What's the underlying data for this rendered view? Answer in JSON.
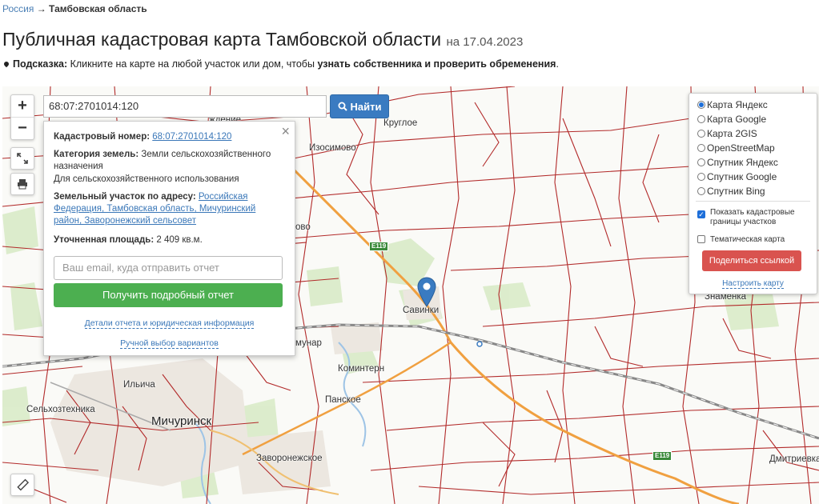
{
  "breadcrumb": {
    "root": "Россия",
    "arrow": "→",
    "current": "Тамбовская область"
  },
  "page": {
    "title": "Публичная кадастровая карта Тамбовской области",
    "date": "на 17.04.2023"
  },
  "hint": {
    "label": "Подсказка:",
    "text": "Кликните на карте на любой участок или дом, чтобы",
    "bold": "узнать собственника и проверить обременения",
    "end": "."
  },
  "map": {
    "zoom_in": "+",
    "zoom_out": "−",
    "search_value": "68:07:2701014:120",
    "search_button": "Найти",
    "road_label": "E119",
    "places": {
      "kruglo": "Круглое",
      "izosimovo": "Изосимово",
      "savinki": "Савинки",
      "kominter": "Коминтерн",
      "panskoe": "Панское",
      "michurinsk": "Мичуринск",
      "selkhoz": "Сельхозтехника",
      "zavoron": "Заворонежское",
      "znamenka": "Знаменка",
      "dmitrievka": "Дмитриевка",
      "ilyich": "Ильича",
      "vo": "ово",
      "munar": "мунар",
      "zhenie": "ждение"
    }
  },
  "popup": {
    "close": "×",
    "cad_label": "Кадастровый номер:",
    "cad_value": "68:07:2701014:120",
    "cat_label": "Категория земель:",
    "cat_value": "Земли сельскохозяйственного назначения",
    "use_value": "Для сельскохозяйственного использования",
    "addr_label": "Земельный участок по адресу:",
    "addr_value": "Российская Федерация, Тамбовская область, Мичуринский район, Заворонежский сельсовет",
    "area_label": "Уточненная площадь:",
    "area_value": "2 409 кв.м.",
    "email_placeholder": "Ваш email, куда отправить отчет",
    "report_button": "Получить подробный отчет",
    "details_link": "Детали отчета и юридическая информация",
    "manual_link": "Ручной выбор вариантов"
  },
  "layers": {
    "options": [
      "Карта Яндекс",
      "Карта Google",
      "Карта 2GIS",
      "OpenStreetMap",
      "Спутник Яндекс",
      "Спутник Google",
      "Спутник Bing"
    ],
    "selected": "Карта Яндекс",
    "show_bounds": "Показать кадастровые границы участков",
    "thematic": "Тематическая карта",
    "share": "Поделиться ссылкой",
    "configure": "Настроить карту"
  },
  "colors": {
    "accent": "#3a7bc1",
    "success": "#4caf50",
    "danger": "#d9534f",
    "parcel": "#b22a2a",
    "road": "#f0a040"
  }
}
